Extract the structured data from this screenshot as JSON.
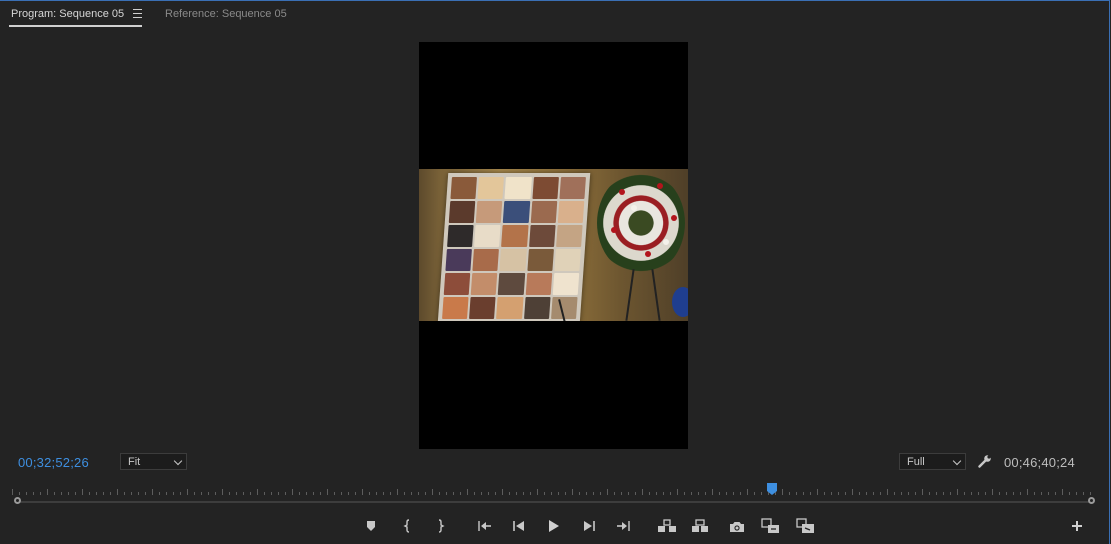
{
  "panel": {
    "tabs": [
      {
        "label": "Program: Sequence 05",
        "active": true
      },
      {
        "label": "Reference: Sequence 05",
        "active": false
      }
    ],
    "menu_icon": "hamburger-menu-icon"
  },
  "monitor": {
    "content": "video-frame",
    "accent_color": "#3e8fe0"
  },
  "controls": {
    "current_timecode": "00;32;52;26",
    "duration_timecode": "00;46;40;24",
    "zoom_select": {
      "value": "Fit"
    },
    "resolution_select": {
      "value": "Full"
    },
    "settings_icon": "wrench-icon"
  },
  "timeline_ruler": {
    "playhead_position": 0.7
  },
  "transport": {
    "buttons": [
      {
        "name": "add-marker-button",
        "icon": "marker-icon"
      },
      {
        "name": "mark-in-button",
        "icon": "mark-in-icon"
      },
      {
        "name": "mark-out-button",
        "icon": "mark-out-icon"
      },
      {
        "name": "go-to-in-button",
        "icon": "go-to-in-icon"
      },
      {
        "name": "step-back-button",
        "icon": "step-back-icon"
      },
      {
        "name": "play-button",
        "icon": "play-icon"
      },
      {
        "name": "step-forward-button",
        "icon": "step-forward-icon"
      },
      {
        "name": "go-to-out-button",
        "icon": "go-to-out-icon"
      },
      {
        "name": "lift-button",
        "icon": "lift-icon"
      },
      {
        "name": "extract-button",
        "icon": "extract-icon"
      },
      {
        "name": "export-frame-button",
        "icon": "camera-icon"
      },
      {
        "name": "insert-button",
        "icon": "insert-icon"
      },
      {
        "name": "overwrite-button",
        "icon": "overwrite-icon"
      }
    ],
    "add_button_icon": "plus-icon"
  }
}
